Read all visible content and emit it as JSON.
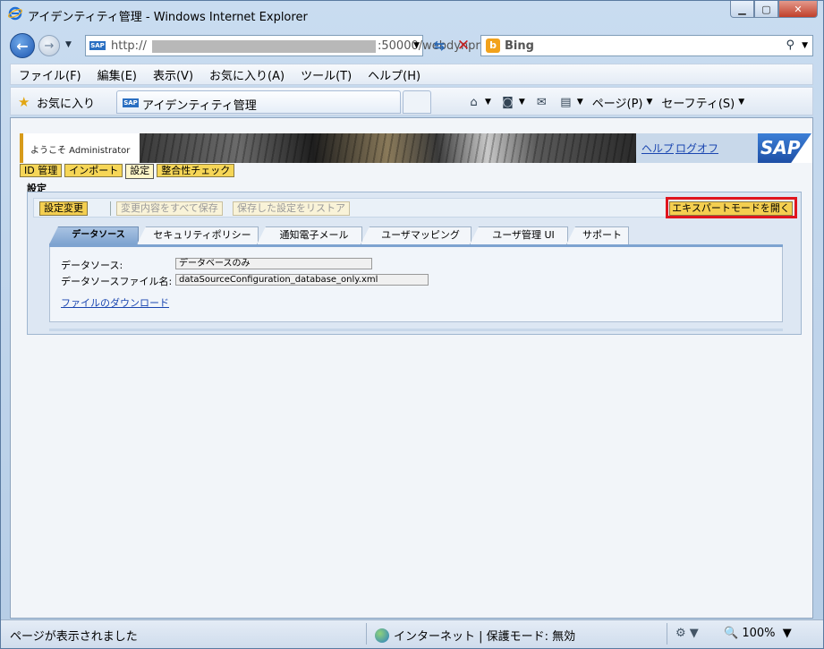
{
  "window": {
    "title": "アイデンティティ管理 - Windows Internet Explorer",
    "controls": [
      "minimize",
      "maximize",
      "close"
    ]
  },
  "address": {
    "url_prefix": "http://",
    "url_suffix": ":50000/webdynpro/",
    "search_provider": "Bing"
  },
  "menubar": [
    "ファイル(F)",
    "編集(E)",
    "表示(V)",
    "お気に入り(A)",
    "ツール(T)",
    "ヘルプ(H)"
  ],
  "favorites": {
    "label": "お気に入り",
    "tab_title": "アイデンティティ管理",
    "page_label": "ページ(P)",
    "safety_label": "セーフティ(S)"
  },
  "sap": {
    "welcome": "ようこそ Administrator",
    "help_link": "ヘルプ",
    "logoff_link": "ログオフ",
    "logo": "SAP",
    "top_tabs": [
      "ID 管理",
      "インポート",
      "設定",
      "整合性チェック"
    ],
    "active_top_tab": 2,
    "page_title": "設定",
    "toolbar": {
      "change": "設定変更",
      "save_all": "変更内容をすべて保存",
      "restore": "保存した設定をリストア",
      "expert_mode": "エキスパートモードを開く"
    },
    "tabs": [
      "データソース",
      "セキュリティポリシー",
      "通知電子メール",
      "ユーザマッピング",
      "ユーザ管理 UI",
      "サポート"
    ],
    "active_tab": 0,
    "fields": {
      "datasource_label": "データソース:",
      "datasource_value": "データベースのみ",
      "file_label": "データソースファイル名:",
      "file_value": "dataSourceConfiguration_database_only.xml"
    },
    "download_link": "ファイルのダウンロード"
  },
  "status": {
    "text": "ページが表示されました",
    "zone": "インターネット | 保護モード: 無効",
    "zoom": "100%"
  },
  "colors": {
    "highlight": "#e0151e",
    "sap_button": "#f4cf50",
    "active_tab": "#7ea3d0"
  }
}
